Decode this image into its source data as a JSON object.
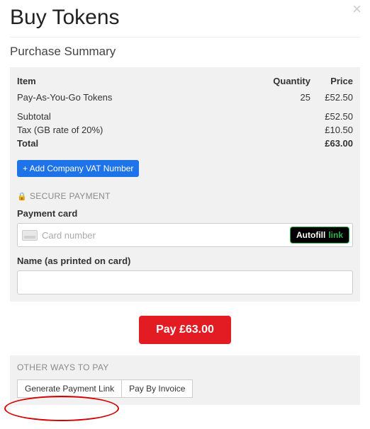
{
  "modal": {
    "title": "Buy Tokens",
    "close_glyph": "×"
  },
  "summary": {
    "heading": "Purchase Summary",
    "cols": {
      "item": "Item",
      "qty": "Quantity",
      "price": "Price"
    },
    "line": {
      "name": "Pay-As-You-Go Tokens",
      "qty": "25",
      "price": "£52.50"
    },
    "subtotal": {
      "label": "Subtotal",
      "value": "£52.50"
    },
    "tax": {
      "label": "Tax (GB rate of 20%)",
      "value": "£10.50"
    },
    "total": {
      "label": "Total",
      "value": "£63.00"
    },
    "vat_button": "+ Add Company VAT Number"
  },
  "payment": {
    "secure_label": "SECURE PAYMENT",
    "card_label": "Payment card",
    "card_placeholder": "Card number",
    "autofill": {
      "brand": "Autofill",
      "suffix": "link"
    },
    "name_label": "Name (as printed on card)",
    "name_value": ""
  },
  "pay_button": "Pay £63.00",
  "other": {
    "heading": "OTHER WAYS TO PAY",
    "gen_link": "Generate Payment Link",
    "invoice": "Pay By Invoice"
  }
}
